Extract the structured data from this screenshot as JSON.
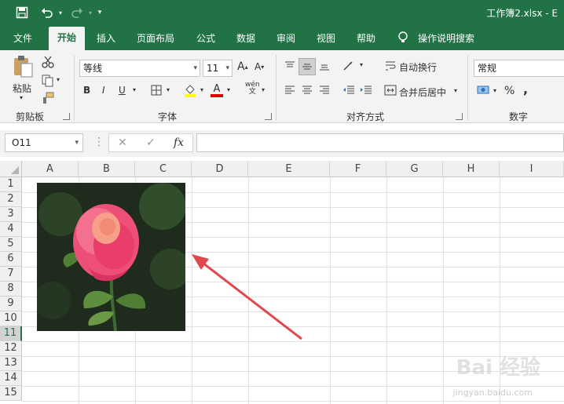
{
  "window": {
    "title": "工作簿2.xlsx  -  E"
  },
  "quick_access": {
    "save_icon": "save-icon",
    "undo_icon": "undo-icon",
    "redo_icon": "redo-icon",
    "customize_icon": "customize-quick-access-icon"
  },
  "tabs": [
    {
      "label": "文件"
    },
    {
      "label": "开始"
    },
    {
      "label": "插入"
    },
    {
      "label": "页面布局"
    },
    {
      "label": "公式"
    },
    {
      "label": "数据"
    },
    {
      "label": "审阅"
    },
    {
      "label": "视图"
    },
    {
      "label": "帮助"
    },
    {
      "label": "操作说明搜索"
    }
  ],
  "ribbon": {
    "clipboard": {
      "label": "剪贴板",
      "paste_label": "粘贴"
    },
    "font": {
      "label": "字体",
      "font_name": "等线",
      "font_size": "11",
      "bold": "B",
      "italic": "I",
      "underline": "U",
      "font_color_glyph": "A",
      "phonetic_glyph": "wén"
    },
    "alignment": {
      "label": "对齐方式",
      "wrap_text": "自动换行",
      "merge_center": "合并后居中"
    },
    "number": {
      "label": "数字",
      "format": "常规",
      "percent": "%",
      "comma": ","
    }
  },
  "formula_bar": {
    "name_box": "O11",
    "fx": "fx",
    "cancel": "✕",
    "enter": "✓",
    "content": ""
  },
  "columns": [
    "A",
    "B",
    "C",
    "D",
    "E",
    "F",
    "G",
    "H",
    "I"
  ],
  "rows": [
    "1",
    "2",
    "3",
    "4",
    "5",
    "6",
    "7",
    "8",
    "9",
    "10",
    "11",
    "12",
    "13",
    "14",
    "15"
  ],
  "selected_row": "11",
  "colors": {
    "brand": "#217346",
    "arrow": "#e0484d"
  },
  "watermark": {
    "text": "Bai 经验",
    "sub": "jingyan.baidu.com"
  }
}
